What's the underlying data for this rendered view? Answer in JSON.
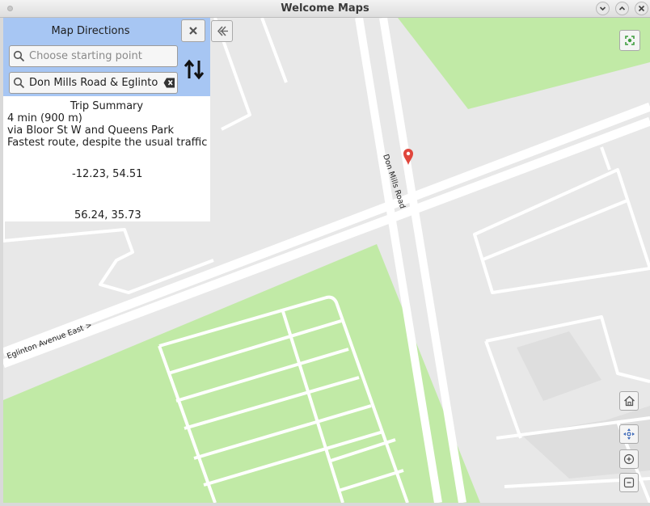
{
  "window": {
    "title": "Welcome Maps"
  },
  "directions": {
    "title": "Map Directions",
    "start": {
      "value": "",
      "placeholder": "Choose starting point"
    },
    "destination": {
      "value": "Don Mills Road & Eglinton",
      "placeholder": ""
    }
  },
  "summary": {
    "title": "Trip Summary",
    "duration": "4 min (900 m)",
    "via": "via Bloor St W and Queens Park",
    "note": "Fastest route, despite the usual traffic",
    "coord_1": "-12.23, 54.51",
    "coord_2": "56.24, 35.73"
  },
  "map": {
    "road_labels": {
      "don_mills": "Don Mills Road",
      "eglinton": "Eglinton Avenue East  >"
    },
    "colors": {
      "background": "#e8e8e8",
      "park": "#c1eaa6",
      "road": "#ffffff",
      "marker": "#e0463c",
      "panel_header": "#a7c6f3"
    }
  },
  "icons": {
    "close": "close-icon",
    "search": "search-icon",
    "clear": "clear-text-icon",
    "swap": "swap-icon",
    "back": "back-arrow-icon",
    "recenter": "recenter-icon",
    "home": "home-icon",
    "pan": "pan-icon",
    "zoom_in": "zoom-in-icon",
    "zoom_out": "zoom-out-icon",
    "marker": "location-marker-icon"
  }
}
